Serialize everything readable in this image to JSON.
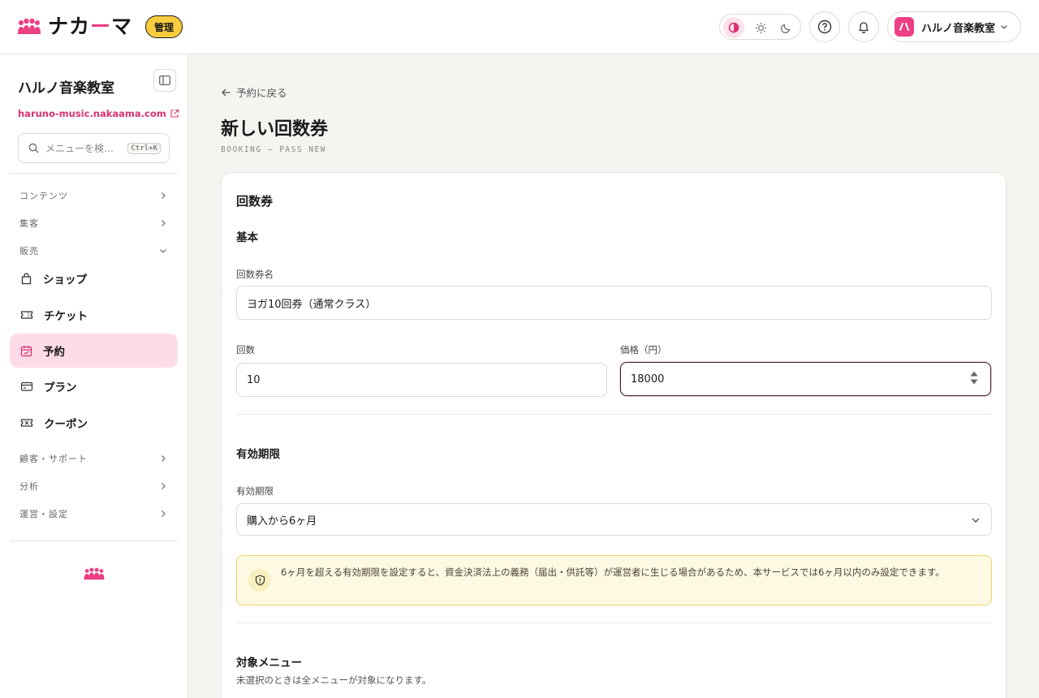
{
  "header": {
    "brand_name_main": "ナカ",
    "brand_name_accent": "ー",
    "brand_name_end": "マ",
    "admin_badge": "管理",
    "account_initial": "ハ",
    "account_name": "ハルノ音楽教室",
    "theme_modes": [
      "contrast-icon",
      "sun-icon",
      "moon-icon"
    ],
    "accent_color": "#ec3f84"
  },
  "sidebar": {
    "site_name": "ハルノ音楽教室",
    "site_url": "haruno-music.nakaama.com",
    "search_placeholder": "メニューを検…",
    "search_shortcut": "Ctrl+K",
    "groups": {
      "contents": "コンテンツ",
      "marketing": "集客",
      "sales": "販売",
      "customers": "顧客・サポート",
      "analytics": "分析",
      "operations": "運営・設定"
    },
    "items": [
      {
        "label": "ショップ",
        "icon": "bag-icon"
      },
      {
        "label": "チケット",
        "icon": "ticket-icon"
      },
      {
        "label": "予約",
        "icon": "calendar-check-icon",
        "active": true
      },
      {
        "label": "プラン",
        "icon": "card-icon"
      },
      {
        "label": "クーポン",
        "icon": "coupon-icon"
      }
    ]
  },
  "main": {
    "back_link": "予約に戻る",
    "title": "新しい回数券",
    "subtitle": "BOOKING — PASS NEW",
    "section_title": "回数券",
    "basic_heading": "基本",
    "name_label": "回数券名",
    "name_value": "ヨガ10回券（通常クラス）",
    "count_label": "回数",
    "count_value": "10",
    "price_label": "価格（円）",
    "price_value": "18000",
    "validity_heading": "有効期限",
    "validity_label": "有効期限",
    "validity_value": "購入から6ヶ月",
    "notice_text": "6ヶ月を超える有効期限を設定すると、資金決済法上の義務（届出・供託等）が運営者に生じる場合があるため、本サービスでは6ヶ月以内のみ設定できます。",
    "target_heading": "対象メニュー",
    "target_hint": "未選択のときは全メニューが対象になります。"
  }
}
